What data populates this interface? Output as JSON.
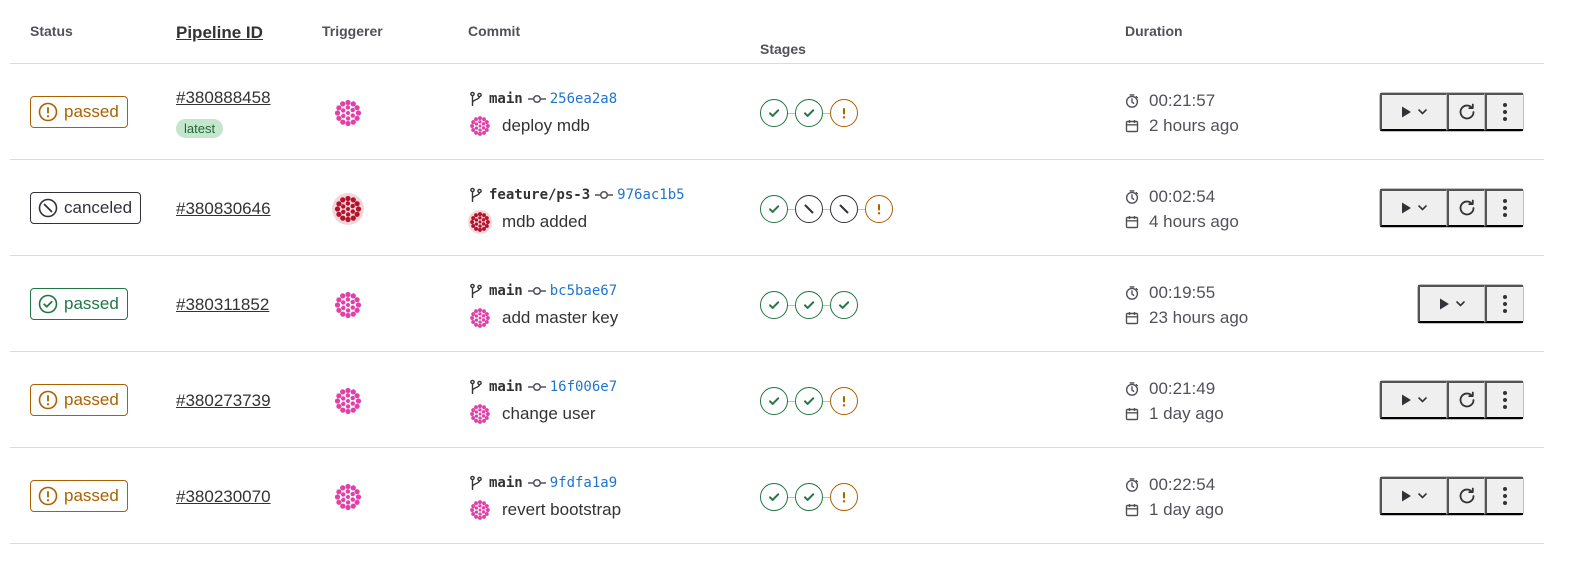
{
  "columns": {
    "status": "Status",
    "pipeline_id": "Pipeline ID",
    "triggerer": "Triggerer",
    "commit": "Commit",
    "stages": "Stages",
    "duration": "Duration"
  },
  "rows": [
    {
      "status": "passed",
      "status_kind": "warning",
      "pipeline_id": "#380888458",
      "tag": "latest",
      "triggerer_avatar": "pink-pattern-avatar",
      "branch": "main",
      "sha": "256ea2a8",
      "message": "deploy mdb",
      "stages": [
        "success",
        "success",
        "warning"
      ],
      "duration": "00:21:57",
      "finished": "2 hours ago",
      "actions": [
        "manual-play",
        "retry",
        "more"
      ]
    },
    {
      "status": "canceled",
      "status_kind": "canceled",
      "pipeline_id": "#380830646",
      "tag": "",
      "triggerer_avatar": "red-pattern-avatar",
      "branch": "feature/ps-3",
      "sha": "976ac1b5",
      "message": "mdb added",
      "stages": [
        "success",
        "canceled",
        "canceled",
        "warning"
      ],
      "duration": "00:02:54",
      "finished": "4 hours ago",
      "actions": [
        "manual-play",
        "retry",
        "more"
      ]
    },
    {
      "status": "passed",
      "status_kind": "success",
      "pipeline_id": "#380311852",
      "tag": "",
      "triggerer_avatar": "pink-pattern-avatar",
      "branch": "main",
      "sha": "bc5bae67",
      "message": "add master key",
      "stages": [
        "success",
        "success",
        "success"
      ],
      "duration": "00:19:55",
      "finished": "23 hours ago",
      "actions": [
        "manual-play",
        "more"
      ]
    },
    {
      "status": "passed",
      "status_kind": "warning",
      "pipeline_id": "#380273739",
      "tag": "",
      "triggerer_avatar": "pink-pattern-avatar",
      "branch": "main",
      "sha": "16f006e7",
      "message": "change user",
      "stages": [
        "success",
        "success",
        "warning"
      ],
      "duration": "00:21:49",
      "finished": "1 day ago",
      "actions": [
        "manual-play",
        "retry",
        "more"
      ]
    },
    {
      "status": "passed",
      "status_kind": "warning",
      "pipeline_id": "#380230070",
      "tag": "",
      "triggerer_avatar": "pink-pattern-avatar",
      "branch": "main",
      "sha": "9fdfa1a9",
      "message": "revert bootstrap",
      "stages": [
        "success",
        "success",
        "warning"
      ],
      "duration": "00:22:54",
      "finished": "1 day ago",
      "actions": [
        "manual-play",
        "retry",
        "more"
      ]
    }
  ],
  "colors": {
    "success": "#217645",
    "warning": "#ab6100",
    "canceled": "#333238",
    "link": "#1f75cb",
    "tag_bg": "#c3e6cd",
    "avatar_pink": "#e040a8",
    "avatar_red": "#b3122a"
  }
}
